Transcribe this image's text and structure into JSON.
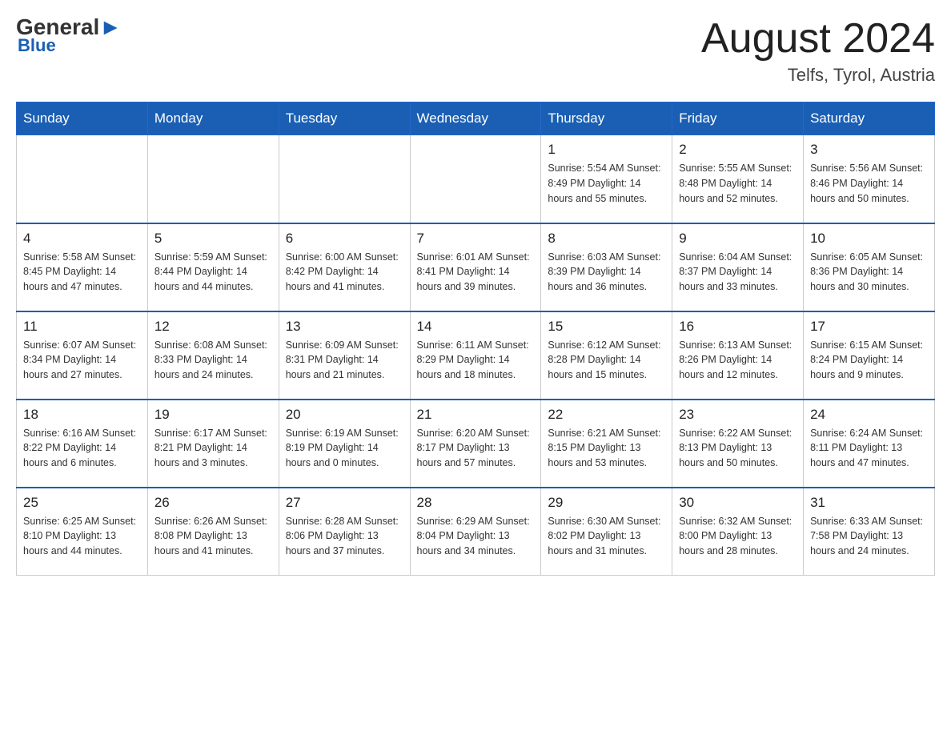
{
  "header": {
    "logo_general": "General",
    "logo_triangle": "▶",
    "logo_blue": "Blue",
    "month_title": "August 2024",
    "location": "Telfs, Tyrol, Austria"
  },
  "days_of_week": [
    "Sunday",
    "Monday",
    "Tuesday",
    "Wednesday",
    "Thursday",
    "Friday",
    "Saturday"
  ],
  "weeks": [
    [
      {
        "day": "",
        "info": ""
      },
      {
        "day": "",
        "info": ""
      },
      {
        "day": "",
        "info": ""
      },
      {
        "day": "",
        "info": ""
      },
      {
        "day": "1",
        "info": "Sunrise: 5:54 AM\nSunset: 8:49 PM\nDaylight: 14 hours\nand 55 minutes."
      },
      {
        "day": "2",
        "info": "Sunrise: 5:55 AM\nSunset: 8:48 PM\nDaylight: 14 hours\nand 52 minutes."
      },
      {
        "day": "3",
        "info": "Sunrise: 5:56 AM\nSunset: 8:46 PM\nDaylight: 14 hours\nand 50 minutes."
      }
    ],
    [
      {
        "day": "4",
        "info": "Sunrise: 5:58 AM\nSunset: 8:45 PM\nDaylight: 14 hours\nand 47 minutes."
      },
      {
        "day": "5",
        "info": "Sunrise: 5:59 AM\nSunset: 8:44 PM\nDaylight: 14 hours\nand 44 minutes."
      },
      {
        "day": "6",
        "info": "Sunrise: 6:00 AM\nSunset: 8:42 PM\nDaylight: 14 hours\nand 41 minutes."
      },
      {
        "day": "7",
        "info": "Sunrise: 6:01 AM\nSunset: 8:41 PM\nDaylight: 14 hours\nand 39 minutes."
      },
      {
        "day": "8",
        "info": "Sunrise: 6:03 AM\nSunset: 8:39 PM\nDaylight: 14 hours\nand 36 minutes."
      },
      {
        "day": "9",
        "info": "Sunrise: 6:04 AM\nSunset: 8:37 PM\nDaylight: 14 hours\nand 33 minutes."
      },
      {
        "day": "10",
        "info": "Sunrise: 6:05 AM\nSunset: 8:36 PM\nDaylight: 14 hours\nand 30 minutes."
      }
    ],
    [
      {
        "day": "11",
        "info": "Sunrise: 6:07 AM\nSunset: 8:34 PM\nDaylight: 14 hours\nand 27 minutes."
      },
      {
        "day": "12",
        "info": "Sunrise: 6:08 AM\nSunset: 8:33 PM\nDaylight: 14 hours\nand 24 minutes."
      },
      {
        "day": "13",
        "info": "Sunrise: 6:09 AM\nSunset: 8:31 PM\nDaylight: 14 hours\nand 21 minutes."
      },
      {
        "day": "14",
        "info": "Sunrise: 6:11 AM\nSunset: 8:29 PM\nDaylight: 14 hours\nand 18 minutes."
      },
      {
        "day": "15",
        "info": "Sunrise: 6:12 AM\nSunset: 8:28 PM\nDaylight: 14 hours\nand 15 minutes."
      },
      {
        "day": "16",
        "info": "Sunrise: 6:13 AM\nSunset: 8:26 PM\nDaylight: 14 hours\nand 12 minutes."
      },
      {
        "day": "17",
        "info": "Sunrise: 6:15 AM\nSunset: 8:24 PM\nDaylight: 14 hours\nand 9 minutes."
      }
    ],
    [
      {
        "day": "18",
        "info": "Sunrise: 6:16 AM\nSunset: 8:22 PM\nDaylight: 14 hours\nand 6 minutes."
      },
      {
        "day": "19",
        "info": "Sunrise: 6:17 AM\nSunset: 8:21 PM\nDaylight: 14 hours\nand 3 minutes."
      },
      {
        "day": "20",
        "info": "Sunrise: 6:19 AM\nSunset: 8:19 PM\nDaylight: 14 hours\nand 0 minutes."
      },
      {
        "day": "21",
        "info": "Sunrise: 6:20 AM\nSunset: 8:17 PM\nDaylight: 13 hours\nand 57 minutes."
      },
      {
        "day": "22",
        "info": "Sunrise: 6:21 AM\nSunset: 8:15 PM\nDaylight: 13 hours\nand 53 minutes."
      },
      {
        "day": "23",
        "info": "Sunrise: 6:22 AM\nSunset: 8:13 PM\nDaylight: 13 hours\nand 50 minutes."
      },
      {
        "day": "24",
        "info": "Sunrise: 6:24 AM\nSunset: 8:11 PM\nDaylight: 13 hours\nand 47 minutes."
      }
    ],
    [
      {
        "day": "25",
        "info": "Sunrise: 6:25 AM\nSunset: 8:10 PM\nDaylight: 13 hours\nand 44 minutes."
      },
      {
        "day": "26",
        "info": "Sunrise: 6:26 AM\nSunset: 8:08 PM\nDaylight: 13 hours\nand 41 minutes."
      },
      {
        "day": "27",
        "info": "Sunrise: 6:28 AM\nSunset: 8:06 PM\nDaylight: 13 hours\nand 37 minutes."
      },
      {
        "day": "28",
        "info": "Sunrise: 6:29 AM\nSunset: 8:04 PM\nDaylight: 13 hours\nand 34 minutes."
      },
      {
        "day": "29",
        "info": "Sunrise: 6:30 AM\nSunset: 8:02 PM\nDaylight: 13 hours\nand 31 minutes."
      },
      {
        "day": "30",
        "info": "Sunrise: 6:32 AM\nSunset: 8:00 PM\nDaylight: 13 hours\nand 28 minutes."
      },
      {
        "day": "31",
        "info": "Sunrise: 6:33 AM\nSunset: 7:58 PM\nDaylight: 13 hours\nand 24 minutes."
      }
    ]
  ]
}
